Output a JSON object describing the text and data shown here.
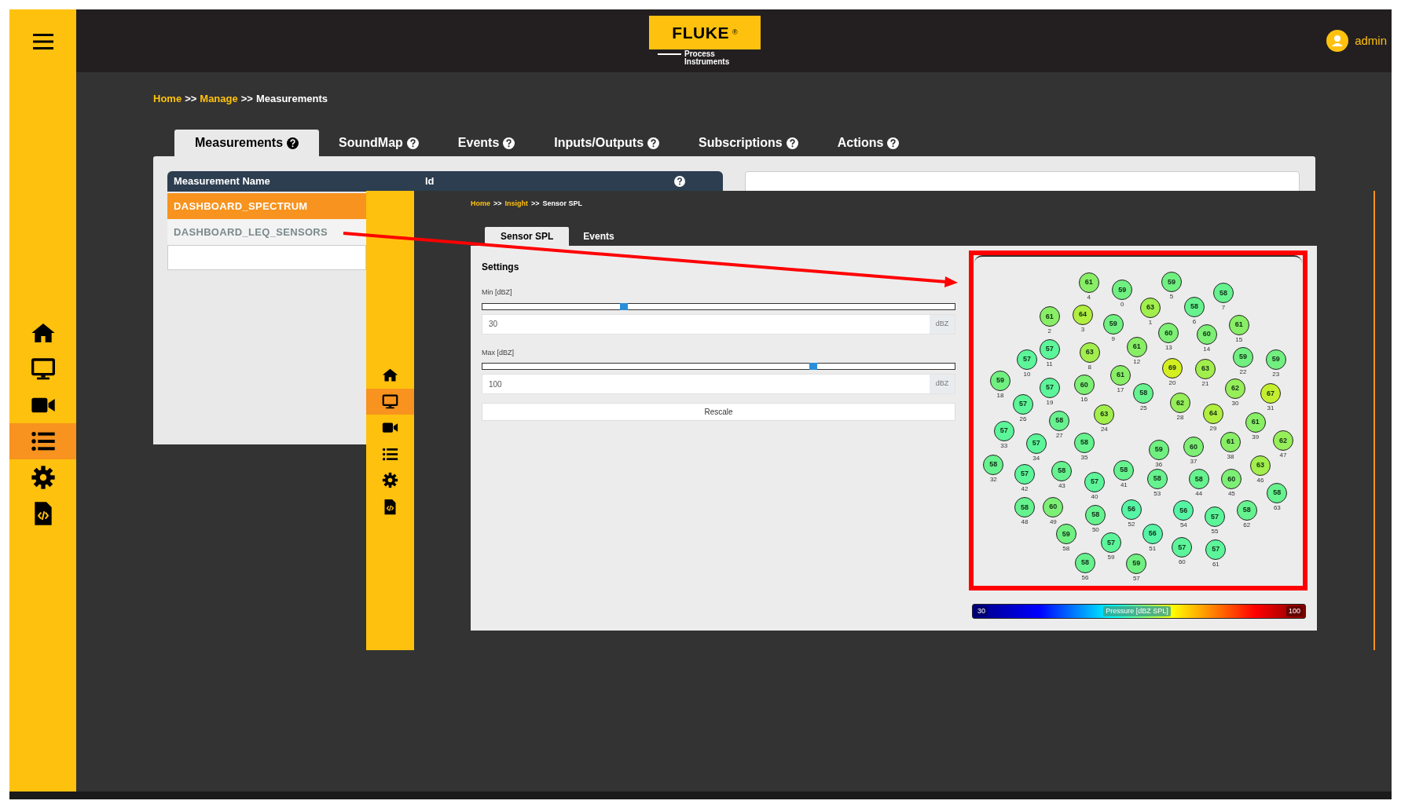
{
  "header": {
    "logo": {
      "brand": "FLUKE",
      "mark": "®",
      "tagline": [
        "Process",
        "Instruments"
      ]
    },
    "user": "admin"
  },
  "sidebar": {
    "items": [
      {
        "kind": "home",
        "selected": false
      },
      {
        "kind": "monitor",
        "selected": false
      },
      {
        "kind": "video",
        "selected": false
      },
      {
        "kind": "list",
        "selected": true
      },
      {
        "kind": "gear",
        "selected": false
      },
      {
        "kind": "file-code",
        "selected": false
      }
    ]
  },
  "breadcrumb": [
    {
      "text": "Home",
      "kind": "link"
    },
    {
      "text": ">>",
      "kind": "separator"
    },
    {
      "text": "Manage",
      "kind": "link"
    },
    {
      "text": ">>",
      "kind": "separator"
    },
    {
      "text": "Measurements",
      "kind": "current"
    }
  ],
  "tabs": [
    {
      "label": "Measurements",
      "selected": true
    },
    {
      "label": "SoundMap",
      "selected": false
    },
    {
      "label": "Events",
      "selected": false
    },
    {
      "label": "Inputs/Outputs",
      "selected": false
    },
    {
      "label": "Subscriptions",
      "selected": false
    },
    {
      "label": "Actions",
      "selected": false
    }
  ],
  "table": {
    "columns": [
      "Measurement Name",
      "Id"
    ],
    "rows": [
      {
        "name": "DASHBOARD_SPECTRUM",
        "selected": true
      },
      {
        "name": "DASHBOARD_LEQ_SENSORS",
        "selected": false
      }
    ]
  },
  "inset": {
    "sidebar": {
      "items": [
        {
          "kind": "home",
          "selected": false
        },
        {
          "kind": "monitor",
          "selected": true
        },
        {
          "kind": "video",
          "selected": false
        },
        {
          "kind": "list",
          "selected": false
        },
        {
          "kind": "gear",
          "selected": false
        },
        {
          "kind": "file-code",
          "selected": false
        }
      ]
    },
    "breadcrumb": [
      {
        "text": "Home",
        "kind": "link"
      },
      {
        "text": ">>",
        "kind": "separator"
      },
      {
        "text": "Insight",
        "kind": "link"
      },
      {
        "text": ">>",
        "kind": "separator"
      },
      {
        "text": "Sensor SPL",
        "kind": "current"
      }
    ],
    "tabs": [
      {
        "label": "Sensor SPL",
        "selected": true
      },
      {
        "label": "Events",
        "selected": false
      }
    ],
    "settings": {
      "title": "Settings",
      "sliders": [
        {
          "label": "Min [dBZ]",
          "level": 0.3,
          "value": "30",
          "unit": "dBZ"
        },
        {
          "label": "Max [dBZ]",
          "level": 0.7,
          "value": "100",
          "unit": "dBZ"
        }
      ],
      "button": "Rescale"
    },
    "sensors": [
      {
        "value": "59",
        "label": "0",
        "color": "#70f080"
      },
      {
        "value": "63",
        "label": "1",
        "color": "#a2ee4c"
      },
      {
        "value": "61",
        "label": "2",
        "color": "#88ee66"
      },
      {
        "value": "64",
        "label": "3",
        "color": "#b0ee40"
      },
      {
        "value": "61",
        "label": "4",
        "color": "#88ee66"
      },
      {
        "value": "59",
        "label": "5",
        "color": "#70f080"
      },
      {
        "value": "58",
        "label": "6",
        "color": "#66f28e"
      },
      {
        "value": "58",
        "label": "7",
        "color": "#66f28e"
      },
      {
        "value": "63",
        "label": "8",
        "color": "#a2ee4c"
      },
      {
        "value": "59",
        "label": "9",
        "color": "#70f080"
      },
      {
        "value": "57",
        "label": "10",
        "color": "#5cf59a"
      },
      {
        "value": "57",
        "label": "11",
        "color": "#5cf59a"
      },
      {
        "value": "61",
        "label": "12",
        "color": "#88ee66"
      },
      {
        "value": "60",
        "label": "13",
        "color": "#7cef74"
      },
      {
        "value": "60",
        "label": "14",
        "color": "#7cef74"
      },
      {
        "value": "61",
        "label": "15",
        "color": "#88ee66"
      },
      {
        "value": "60",
        "label": "16",
        "color": "#7cef74"
      },
      {
        "value": "61",
        "label": "17",
        "color": "#88ee66"
      },
      {
        "value": "59",
        "label": "18",
        "color": "#70f080"
      },
      {
        "value": "57",
        "label": "19",
        "color": "#5cf59a"
      },
      {
        "value": "69",
        "label": "20",
        "color": "#d4ee20"
      },
      {
        "value": "63",
        "label": "21",
        "color": "#a2ee4c"
      },
      {
        "value": "59",
        "label": "22",
        "color": "#70f080"
      },
      {
        "value": "59",
        "label": "23",
        "color": "#70f080"
      },
      {
        "value": "63",
        "label": "24",
        "color": "#a2ee4c"
      },
      {
        "value": "58",
        "label": "25",
        "color": "#66f28e"
      },
      {
        "value": "57",
        "label": "26",
        "color": "#5cf59a"
      },
      {
        "value": "58",
        "label": "27",
        "color": "#66f28e"
      },
      {
        "value": "62",
        "label": "28",
        "color": "#96ee58"
      },
      {
        "value": "64",
        "label": "29",
        "color": "#b0ee40"
      },
      {
        "value": "62",
        "label": "30",
        "color": "#96ee58"
      },
      {
        "value": "67",
        "label": "31",
        "color": "#c4ee30"
      },
      {
        "value": "58",
        "label": "32",
        "color": "#66f28e"
      },
      {
        "value": "57",
        "label": "33",
        "color": "#5cf59a"
      },
      {
        "value": "57",
        "label": "34",
        "color": "#5cf59a"
      },
      {
        "value": "58",
        "label": "35",
        "color": "#66f28e"
      },
      {
        "value": "59",
        "label": "36",
        "color": "#70f080"
      },
      {
        "value": "60",
        "label": "37",
        "color": "#7cef74"
      },
      {
        "value": "61",
        "label": "38",
        "color": "#88ee66"
      },
      {
        "value": "61",
        "label": "39",
        "color": "#88ee66"
      },
      {
        "value": "57",
        "label": "40",
        "color": "#5cf59a"
      },
      {
        "value": "58",
        "label": "41",
        "color": "#66f28e"
      },
      {
        "value": "57",
        "label": "42",
        "color": "#5cf59a"
      },
      {
        "value": "58",
        "label": "43",
        "color": "#66f28e"
      },
      {
        "value": "58",
        "label": "44",
        "color": "#66f28e"
      },
      {
        "value": "60",
        "label": "45",
        "color": "#7cef74"
      },
      {
        "value": "63",
        "label": "46",
        "color": "#a2ee4c"
      },
      {
        "value": "62",
        "label": "47",
        "color": "#96ee58"
      },
      {
        "value": "58",
        "label": "48",
        "color": "#66f28e"
      },
      {
        "value": "60",
        "label": "49",
        "color": "#7cef74"
      },
      {
        "value": "58",
        "label": "50",
        "color": "#66f28e"
      },
      {
        "value": "56",
        "label": "51",
        "color": "#55f5a5"
      },
      {
        "value": "56",
        "label": "52",
        "color": "#55f5a5"
      },
      {
        "value": "58",
        "label": "53",
        "color": "#66f28e"
      },
      {
        "value": "56",
        "label": "54",
        "color": "#55f5a5"
      },
      {
        "value": "57",
        "label": "55",
        "color": "#5cf59a"
      },
      {
        "value": "58",
        "label": "56",
        "color": "#66f28e"
      },
      {
        "value": "59",
        "label": "57",
        "color": "#70f080"
      },
      {
        "value": "59",
        "label": "58",
        "color": "#70f080"
      },
      {
        "value": "57",
        "label": "59",
        "color": "#5cf59a"
      },
      {
        "value": "57",
        "label": "60",
        "color": "#5cf59a"
      },
      {
        "value": "57",
        "label": "61",
        "color": "#5cf59a"
      },
      {
        "value": "58",
        "label": "62",
        "color": "#66f28e"
      },
      {
        "value": "58",
        "label": "63",
        "color": "#66f28e"
      }
    ],
    "colorbar": {
      "min": "30",
      "title": "Pressure [dBZ SPL]",
      "max": "100"
    }
  }
}
